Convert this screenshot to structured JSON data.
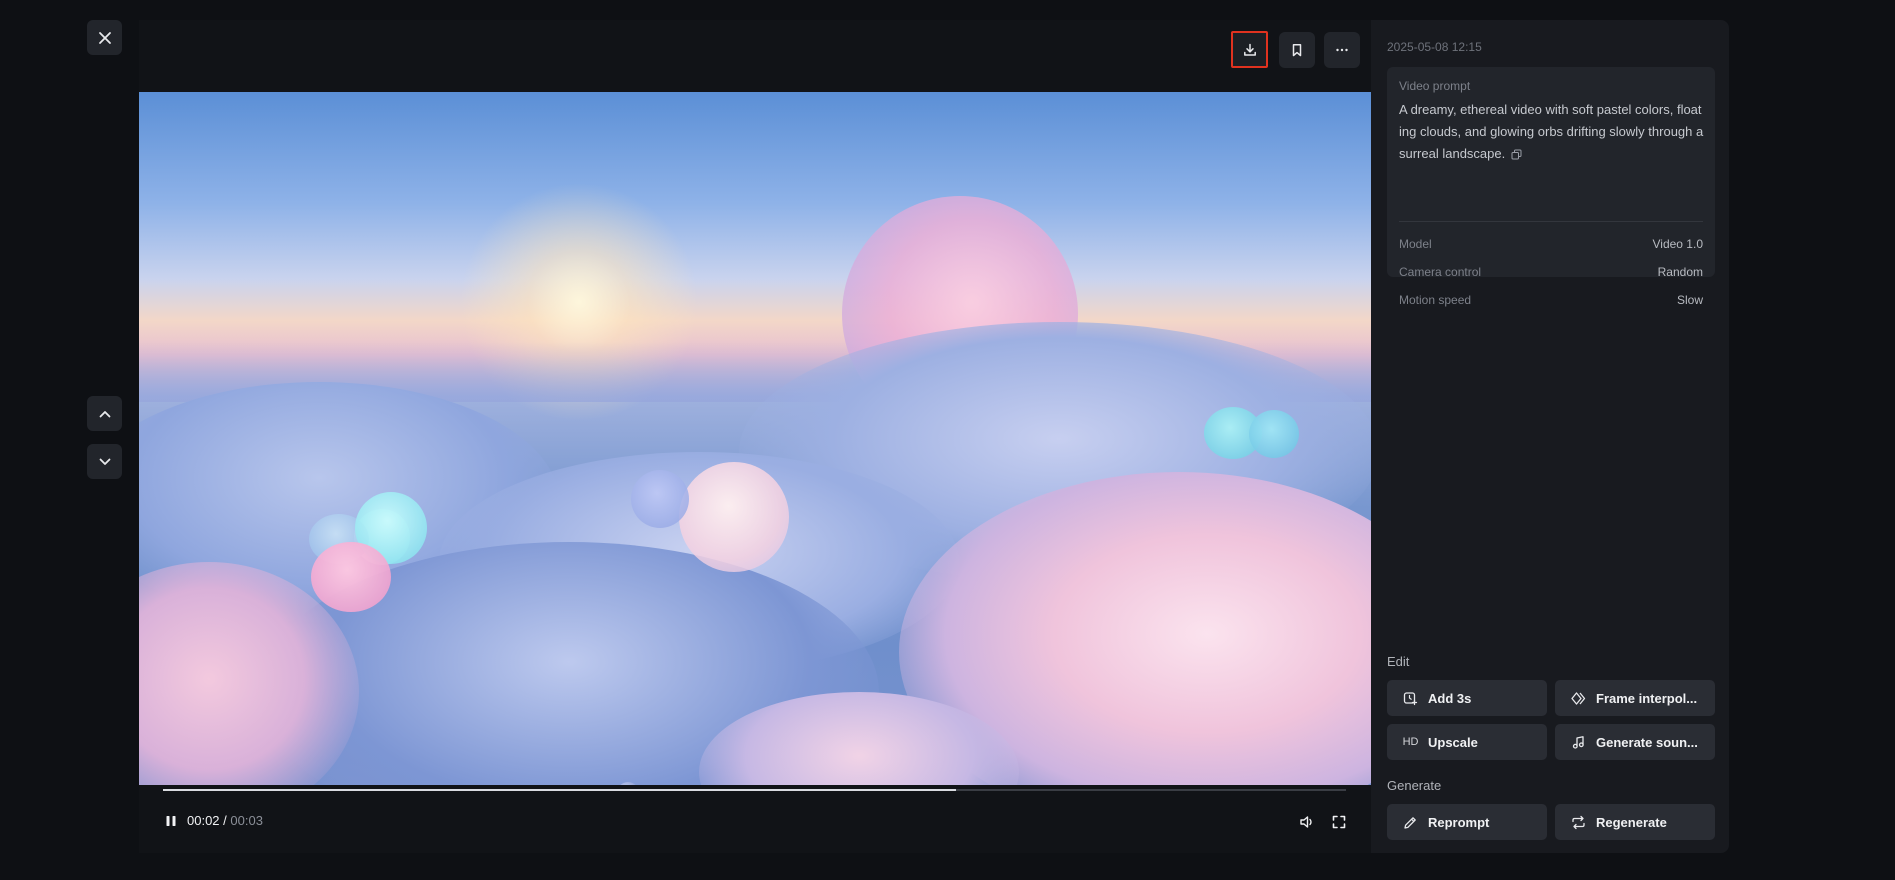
{
  "player": {
    "time_current": "00:02",
    "time_separator": " / ",
    "time_total": "00:03",
    "progress": 0.67
  },
  "panel": {
    "timestamp": "2025-05-08 12:15",
    "prompt_label": "Video prompt",
    "prompt_text": "A dreamy, ethereal video with soft pastel colors, floating clouds, and glowing orbs drifting slowly through a surreal landscape.",
    "meta": [
      {
        "key": "Model",
        "value": "Video 1.0"
      },
      {
        "key": "Camera control",
        "value": "Random"
      },
      {
        "key": "Motion speed",
        "value": "Slow"
      }
    ],
    "edit_label": "Edit",
    "edit_actions": [
      {
        "label": "Add 3s",
        "icon": "add-time-icon"
      },
      {
        "label": "Frame interpol...",
        "icon": "frame-interpolation-icon"
      },
      {
        "label": "Upscale",
        "icon": "hd-icon",
        "icon_text": "HD"
      },
      {
        "label": "Generate soun...",
        "icon": "music-note-icon"
      }
    ],
    "generate_label": "Generate",
    "generate_actions": [
      {
        "label": "Reprompt",
        "icon": "pencil-icon"
      },
      {
        "label": "Regenerate",
        "icon": "refresh-icon"
      }
    ]
  },
  "colors": {
    "background": "#0e1014",
    "panel": "#181a1f",
    "card": "#22252b",
    "button": "#2a2d34",
    "highlight_border": "#e0321f"
  }
}
